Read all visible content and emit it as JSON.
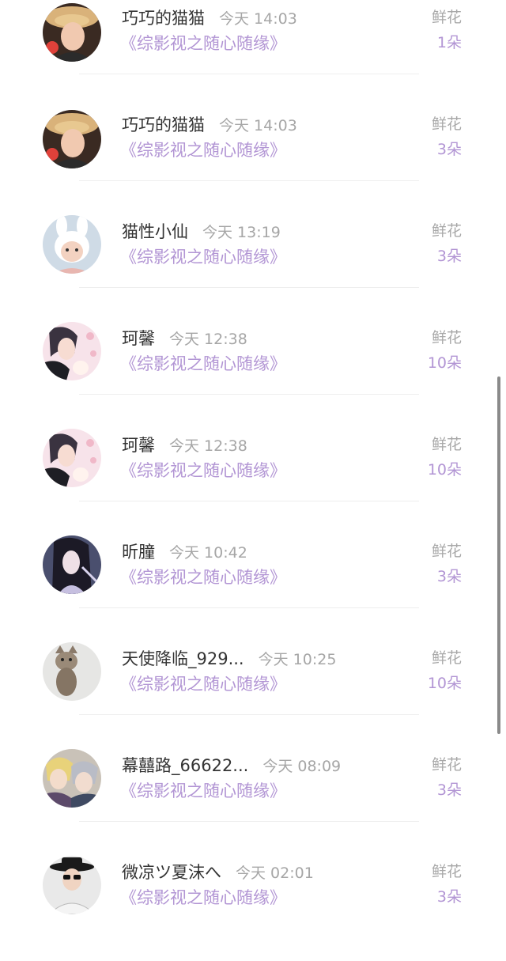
{
  "rows": [
    {
      "name": "巧巧的猫猫",
      "time": "今天 14:03",
      "work": "《综影视之随心随缘》",
      "gift_label": "鲜花",
      "gift_count": "1朵",
      "avatar_icon": "woman-hat-avatar-icon"
    },
    {
      "name": "巧巧的猫猫",
      "time": "今天 14:03",
      "work": "《综影视之随心随缘》",
      "gift_label": "鲜花",
      "gift_count": "3朵",
      "avatar_icon": "woman-hat-avatar-icon"
    },
    {
      "name": "猫性小仙",
      "time": "今天 13:19",
      "work": "《综影视之随心随缘》",
      "gift_label": "鲜花",
      "gift_count": "3朵",
      "avatar_icon": "baby-bunny-ears-avatar-icon"
    },
    {
      "name": "珂馨",
      "time": "今天 12:38",
      "work": "《综影视之随心随缘》",
      "gift_label": "鲜花",
      "gift_count": "10朵",
      "avatar_icon": "anime-couple-avatar-icon"
    },
    {
      "name": "珂馨",
      "time": "今天 12:38",
      "work": "《综影视之随心随缘》",
      "gift_label": "鲜花",
      "gift_count": "10朵",
      "avatar_icon": "anime-couple-avatar-icon"
    },
    {
      "name": "昕朣",
      "time": "今天 10:42",
      "work": "《综影视之随心随缘》",
      "gift_label": "鲜花",
      "gift_count": "3朵",
      "avatar_icon": "anime-girl-avatar-icon"
    },
    {
      "name": "天使降临_929...",
      "time": "今天 10:25",
      "work": "《综影视之随心随缘》",
      "gift_label": "鲜花",
      "gift_count": "10朵",
      "avatar_icon": "kitten-avatar-icon"
    },
    {
      "name": "幕囍路_66622...",
      "time": "今天 08:09",
      "work": "《综影视之随心随缘》",
      "gift_label": "鲜花",
      "gift_count": "3朵",
      "avatar_icon": "anime-boys-avatar-icon"
    },
    {
      "name": "微凉ツ夏沫へ",
      "time": "今天 02:01",
      "work": "《综影视之随心随缘》",
      "gift_label": "鲜花",
      "gift_count": "3朵",
      "avatar_icon": "boy-sunglasses-avatar-icon"
    }
  ],
  "colors": {
    "name": "#333333",
    "time": "#a6a6a6",
    "accent_purple": "#b295d4",
    "gift_label": "#a8a8a8",
    "divider": "#eeeeee"
  }
}
